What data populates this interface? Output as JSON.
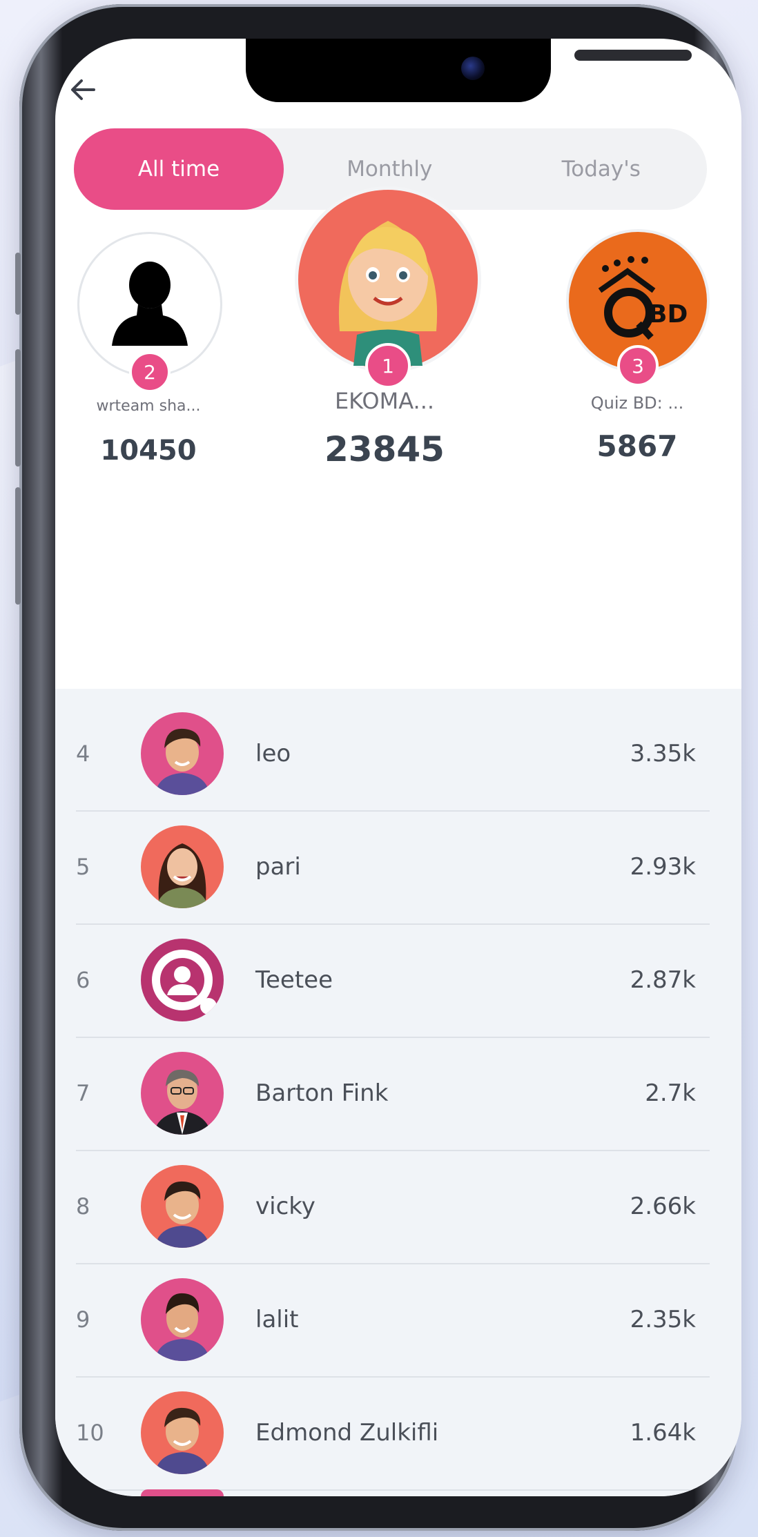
{
  "tabs": [
    {
      "label": "All time",
      "active": true
    },
    {
      "label": "Monthly",
      "active": false
    },
    {
      "label": "Today's",
      "active": false
    }
  ],
  "podium": {
    "first": {
      "rank": "1",
      "name": "EKOMA...",
      "score": "23845",
      "avatar": "blonde-woman-avatar"
    },
    "second": {
      "rank": "2",
      "name": "wrteam sha...",
      "score": "10450",
      "avatar": "default-user-silhouette"
    },
    "third": {
      "rank": "3",
      "name": "Quiz BD: ...",
      "score": "5867",
      "avatar": "qbd-logo"
    }
  },
  "list": [
    {
      "rank": "4",
      "name": "leo",
      "score": "3.35k",
      "avatar": "man-avatar",
      "bg": "#e0508a"
    },
    {
      "rank": "5",
      "name": "pari",
      "score": "2.93k",
      "avatar": "woman-avatar",
      "bg": "#f06a5c"
    },
    {
      "rank": "6",
      "name": "Teetee",
      "score": "2.87k",
      "avatar": "ring-user-icon",
      "bg": "#b8336f"
    },
    {
      "rank": "7",
      "name": "Barton Fink",
      "score": "2.7k",
      "avatar": "suit-man-avatar",
      "bg": "#e0508a"
    },
    {
      "rank": "8",
      "name": "vicky",
      "score": "2.66k",
      "avatar": "man-avatar",
      "bg": "#f06a5c"
    },
    {
      "rank": "9",
      "name": "lalit",
      "score": "2.35k",
      "avatar": "man-avatar",
      "bg": "#e0508a"
    },
    {
      "rank": "10",
      "name": "Edmond Zulkifli",
      "score": "1.64k",
      "avatar": "man-avatar",
      "bg": "#f06a5c"
    }
  ],
  "colors": {
    "accent": "#e94d87",
    "tab_bg": "#f1f2f4",
    "list_bg": "#f1f4f8",
    "text_dark": "#3b4450"
  }
}
